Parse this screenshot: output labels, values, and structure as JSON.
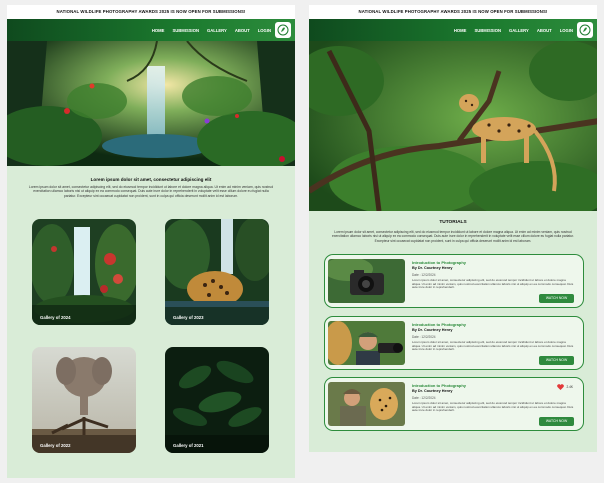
{
  "announcement": "NATIONAL WILDLIFE PHOTOGRAPHY AWARDS 2025 IS NOW OPEN FOR SUBMISSIONS!",
  "nav": [
    "HOME",
    "SUBMISSION",
    "GALLERY",
    "ABOUT",
    "LOGIN"
  ],
  "intro": {
    "title": "Lorem ipsum dolor sit amet, consectetur adipiscing elit",
    "body": "Lorem ipsum dolor sit amet, consectetur adipiscing elit, sed do eiusmod tempor incididunt ut labore et dolore magna aliqua. Ut enim ad minim veniam, quis nostrud exercitation ullamco laboris nisi ut aliquip ex ea commodo consequat. Duis aute irure dolor in reprehenderit in voluptate velit esse cillum dolore eu fugiat nulla pariatur. Excepteur sint occaecat cupidatat non proident, sunt in culpa qui officia deserunt mollit anim id est laborum."
  },
  "galleries": [
    {
      "label": "Gallery of 2024",
      "scene": "waterfall"
    },
    {
      "label": "Gallery of 2023",
      "scene": "jaguar"
    },
    {
      "label": "Gallery of 2022",
      "scene": "elephant"
    },
    {
      "label": "Gallery of 2021",
      "scene": "leaves"
    }
  ],
  "tutorials": {
    "title": "TUTORIALS",
    "intro": "Lorem ipsum dolor sit amet, consectetur adipiscing elit, sed do eiusmod tempor incididunt ut labore et dolore magna aliqua. Ut enim ad minim veniam, quis nostrud exercitation ullamco laboris nisi ut aliquip ex ea commodo consequat. Duis aute irure dolor in reprehenderit in voluptate velit esse cillum dolore eu fugiat nulla pariatur. Excepteur sint occaecat cupidatat non proident, sunt in culpa qui officia deserunt mollit anim id est laborum.",
    "items": [
      {
        "name": "Introduction to Photography",
        "author": "By Dr. Courtney Henry",
        "date": "Date : 12/2/2024",
        "desc": "Lorem ipsum dolor sit amet, consectetur adipiscing elit, sed do eiusmod tempor incididunt ut labore et dolore magna aliqua. Ut enim ad minim veniam, quis nostrud exercitation ullamco laboris nisi ut aliquip ex ea commodo consequat. Duis aute irure dolor in reprehenderit.",
        "button": "WATCH NOW",
        "thumb": "camera"
      },
      {
        "name": "Introduction to Photography",
        "author": "By Dr. Courtney Henry",
        "date": "Date : 12/2/2024",
        "desc": "Lorem ipsum dolor sit amet, consectetur adipiscing elit, sed do eiusmod tempor incididunt ut labore et dolore magna aliqua. Ut enim ad minim veniam, quis nostrud exercitation ullamco laboris nisi ut aliquip ex ea commodo consequat. Duis aute irure dolor in reprehenderit.",
        "button": "WATCH NOW",
        "thumb": "photographer"
      },
      {
        "name": "Introduction to Photography",
        "author": "By Dr. Courtney Henry",
        "date": "Date : 12/2/2024",
        "desc": "Lorem ipsum dolor sit amet, consectetur adipiscing elit, sed do eiusmod tempor incididunt ut labore et dolore magna aliqua. Ut enim ad minim veniam, quis nostrud exercitation ullamco laboris nisi ut aliquip ex ea commodo consequat. Duis aute irure dolor in reprehenderit.",
        "button": "WATCH NOW",
        "thumb": "cheetah",
        "likes": "2.4K"
      }
    ]
  },
  "colors": {
    "accent": "#2f8a3e",
    "nav_dark": "#0f4a1e",
    "panel_bg": "#d9ecd7"
  },
  "icons": {
    "logo": "leaf-camera-logo",
    "like": "heart-icon"
  }
}
